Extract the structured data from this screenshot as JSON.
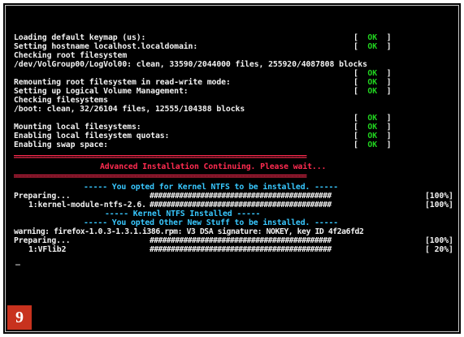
{
  "lines": [
    {
      "text": "Loading default keymap (us):",
      "ok": true
    },
    {
      "text": "Setting hostname localhost.localdomain:",
      "ok": true
    },
    {
      "text": "Checking root filesystem",
      "ok": false
    },
    {
      "text": "/dev/VolGroup00/LogVol00: clean, 33590/2044000 files, 255920/4087808 blocks",
      "ok": false
    },
    {
      "text": "",
      "ok": true
    },
    {
      "text": "Remounting root filesystem in read-write mode:",
      "ok": true
    },
    {
      "text": "Setting up Logical Volume Management:",
      "ok": true
    },
    {
      "text": "Checking filesystems",
      "ok": false
    },
    {
      "text": "/boot: clean, 32/26104 files, 12555/104388 blocks",
      "ok": false
    },
    {
      "text": "",
      "ok": true
    },
    {
      "text": "Mounting local filesystems:",
      "ok": true
    },
    {
      "text": "Enabling local filesystem quotas:",
      "ok": true
    },
    {
      "text": "Enabling swap space:",
      "ok": true
    }
  ],
  "ok_label": "OK",
  "separator": "=====================================================================================",
  "banner": "Advanced Installation Continuing. Please wait...",
  "ntfs_opted": "----- You opted for Kernel NTFS to be installed. -----",
  "preparing_label": "Preparing...",
  "progress_bar": "###########################################",
  "pct_100": "[100%]",
  "pct_20": "[ 20%]",
  "pkg_ntfs": "1:kernel-module-ntfs-2.6.",
  "ntfs_installed": "----- Kernel NTFS Installed -----",
  "new_stuff": "----- You opted Other New Stuff to be installed. -----",
  "warning": "warning: firefox-1.0.3-1.3.1.i386.rpm: V3 DSA signature: NOKEY, key ID 4f2a6fd2",
  "pkg_vflib": "1:VFlib2",
  "cursor": "_",
  "badge_number": "9"
}
